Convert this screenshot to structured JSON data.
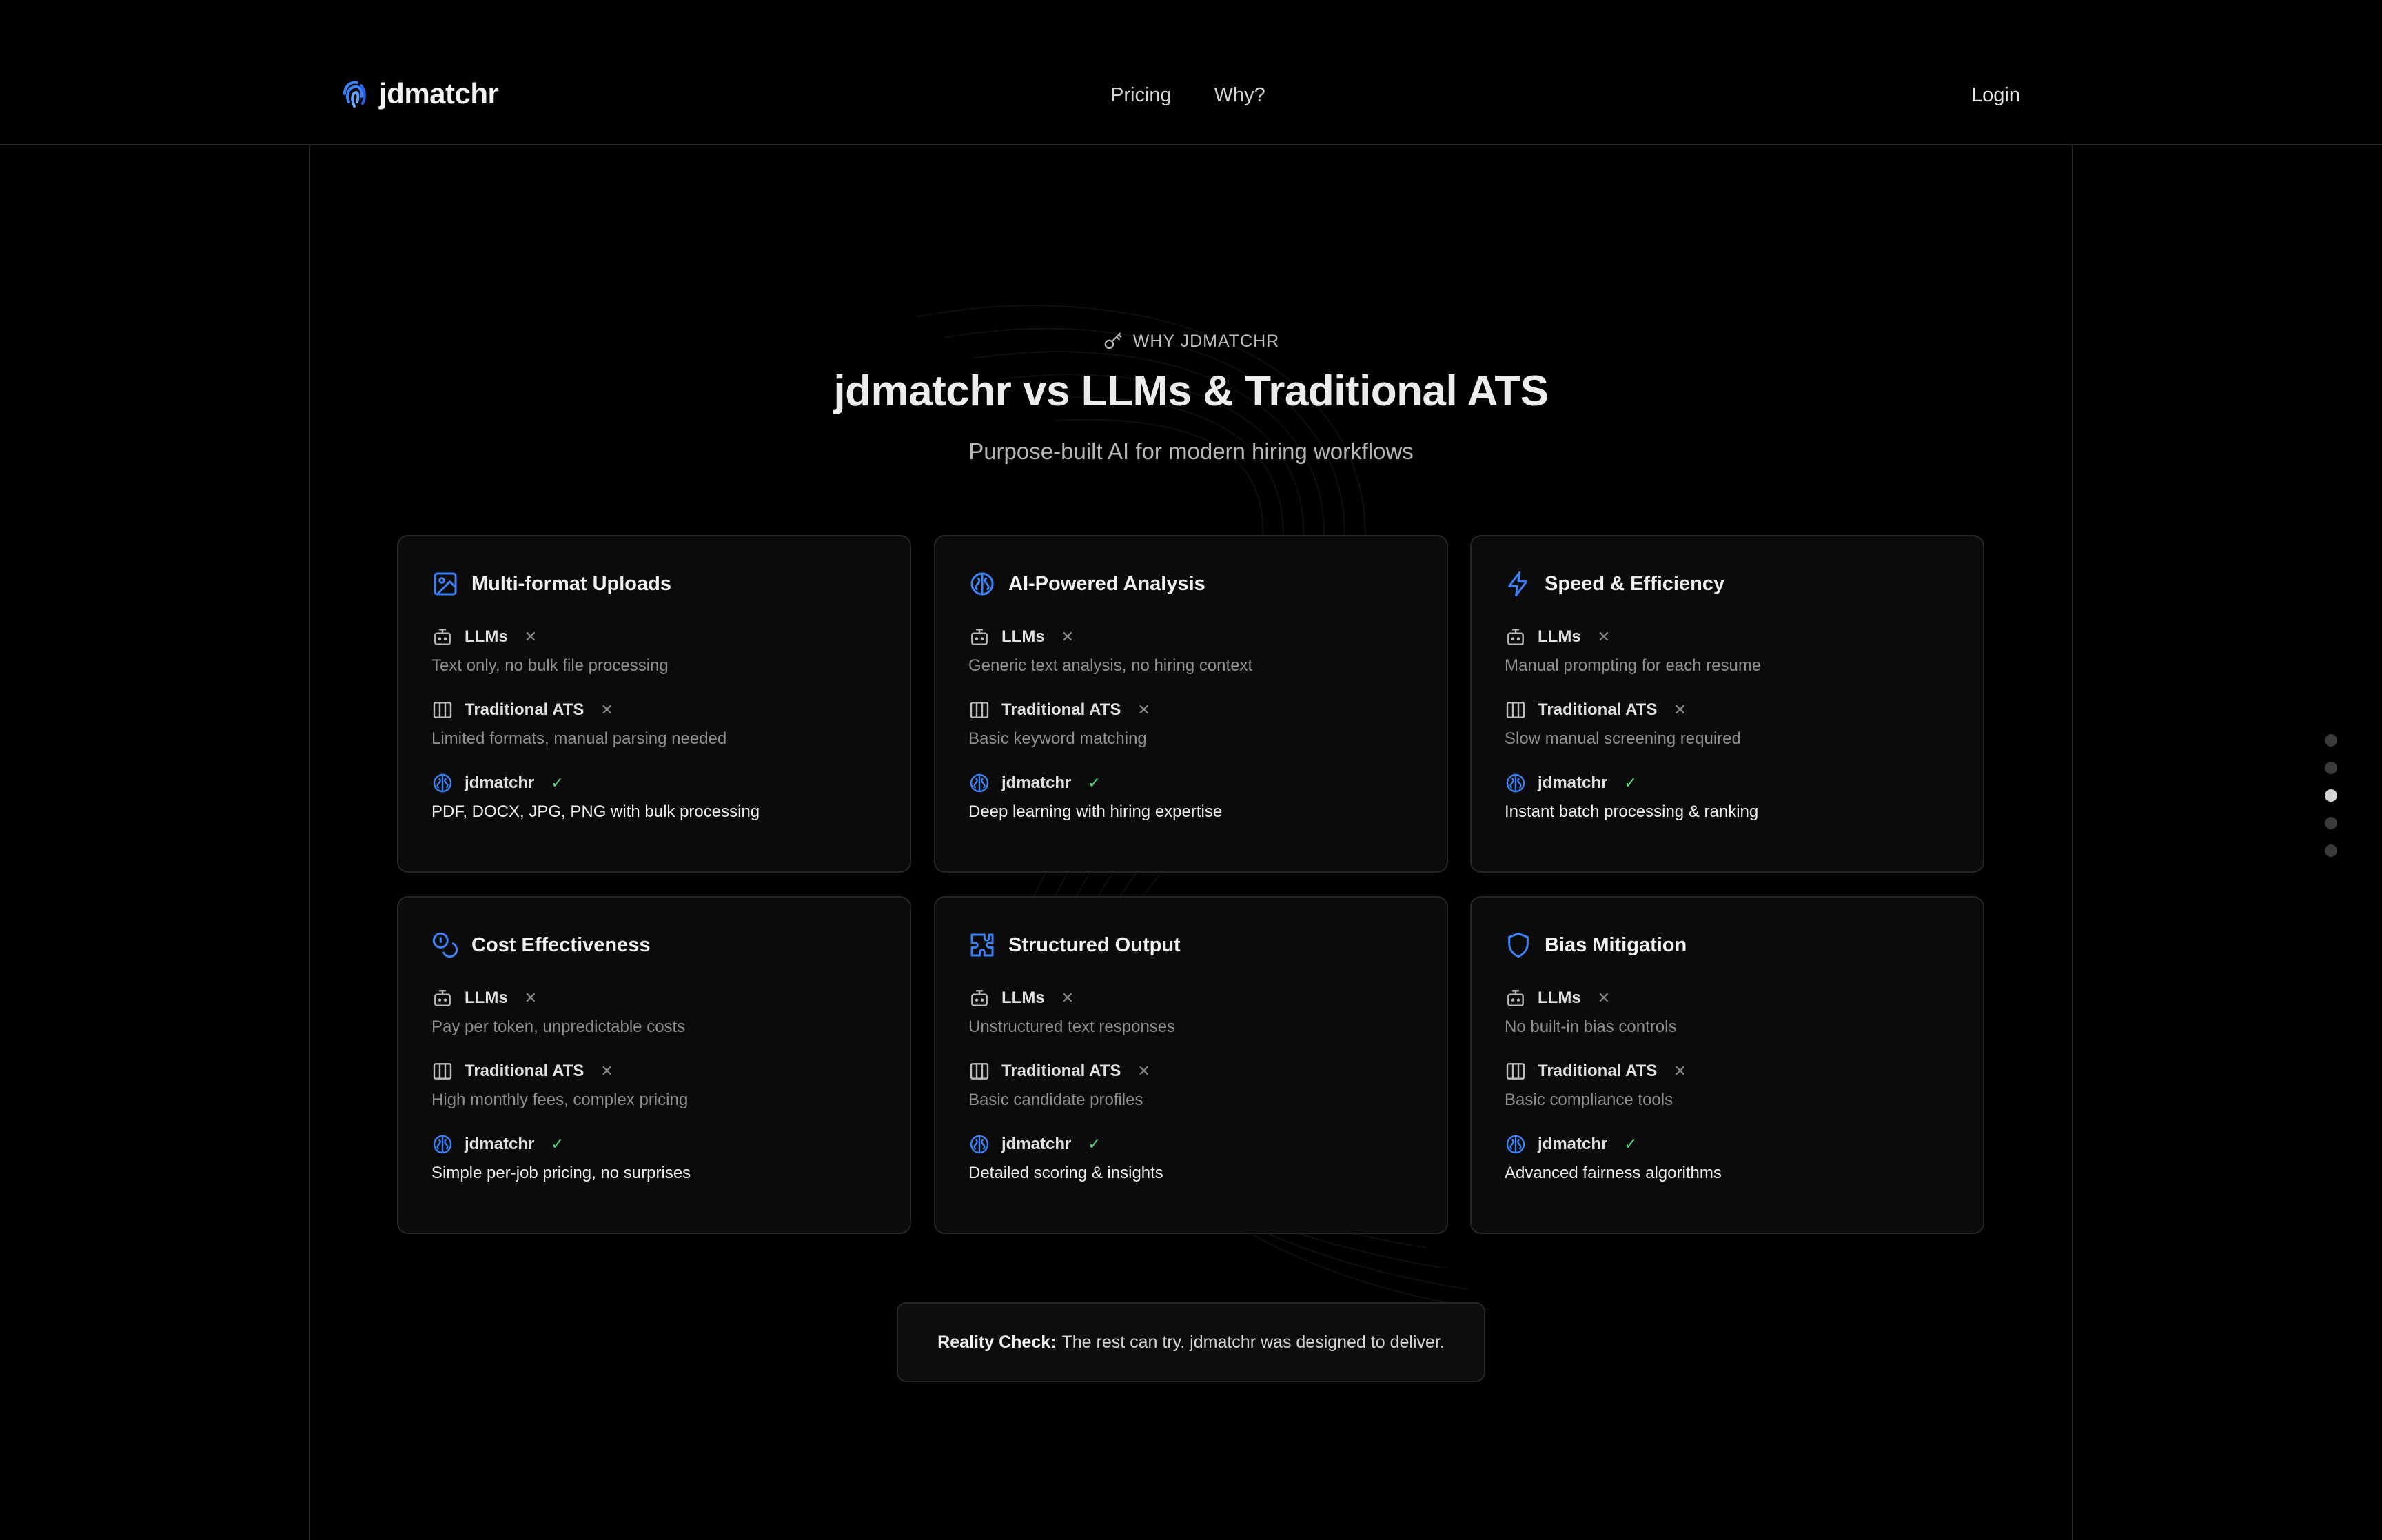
{
  "header": {
    "logo_text": "jdmatchr",
    "nav": [
      {
        "label": "Pricing"
      },
      {
        "label": "Why?"
      }
    ],
    "login_label": "Login"
  },
  "section": {
    "eyebrow": "WHY JDMATCHR",
    "title": "jdmatchr vs LLMs & Traditional ATS",
    "subtitle": "Purpose-built AI for modern hiring workflows"
  },
  "cards": [
    {
      "icon": "image-icon",
      "title": "Multi-format Uploads",
      "llm_label": "LLMs",
      "llm_desc": "Text only, no bulk file processing",
      "ats_label": "Traditional ATS",
      "ats_desc": "Limited formats, manual parsing needed",
      "jd_label": "jdmatchr",
      "jd_desc": "PDF, DOCX, JPG, PNG with bulk processing"
    },
    {
      "icon": "brain-icon",
      "title": "AI-Powered Analysis",
      "llm_label": "LLMs",
      "llm_desc": "Generic text analysis, no hiring context",
      "ats_label": "Traditional ATS",
      "ats_desc": "Basic keyword matching",
      "jd_label": "jdmatchr",
      "jd_desc": "Deep learning with hiring expertise"
    },
    {
      "icon": "lightning-icon",
      "title": "Speed & Efficiency",
      "llm_label": "LLMs",
      "llm_desc": "Manual prompting for each resume",
      "ats_label": "Traditional ATS",
      "ats_desc": "Slow manual screening required",
      "jd_label": "jdmatchr",
      "jd_desc": "Instant batch processing & ranking"
    },
    {
      "icon": "coins-icon",
      "title": "Cost Effectiveness",
      "llm_label": "LLMs",
      "llm_desc": "Pay per token, unpredictable costs",
      "ats_label": "Traditional ATS",
      "ats_desc": "High monthly fees, complex pricing",
      "jd_label": "jdmatchr",
      "jd_desc": "Simple per-job pricing, no surprises"
    },
    {
      "icon": "puzzle-icon",
      "title": "Structured Output",
      "llm_label": "LLMs",
      "llm_desc": "Unstructured text responses",
      "ats_label": "Traditional ATS",
      "ats_desc": "Basic candidate profiles",
      "jd_label": "jdmatchr",
      "jd_desc": "Detailed scoring & insights"
    },
    {
      "icon": "shield-icon",
      "title": "Bias Mitigation",
      "llm_label": "LLMs",
      "llm_desc": "No built-in bias controls",
      "ats_label": "Traditional ATS",
      "ats_desc": "Basic compliance tools",
      "jd_label": "jdmatchr",
      "jd_desc": "Advanced fairness algorithms"
    }
  ],
  "marks": {
    "no": "✕",
    "yes": "✓"
  },
  "reality": {
    "label": "Reality Check:",
    "text": "The rest can try. jdmatchr was designed to deliver."
  },
  "colors": {
    "accent": "#3b82f6",
    "success": "#4ade80",
    "background": "#000000",
    "card": "#0b0b0b",
    "border": "#262626"
  },
  "page_dots": {
    "count": 5,
    "active_index": 2
  }
}
